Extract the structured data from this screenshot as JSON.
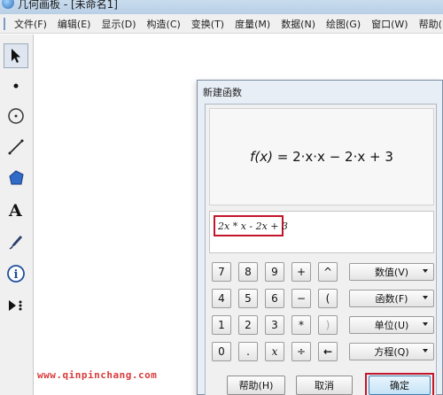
{
  "window": {
    "title": "几何画板 - [未命名1]"
  },
  "menu": [
    "文件(F)",
    "编辑(E)",
    "显示(D)",
    "构造(C)",
    "变换(T)",
    "度量(M)",
    "数据(N)",
    "绘图(G)",
    "窗口(W)",
    "帮助(H)"
  ],
  "toolbox": [
    "arrow-tool-icon",
    "point-tool-icon",
    "compass-tool-icon",
    "line-tool-icon",
    "polygon-tool-icon",
    "text-tool-icon",
    "marker-tool-icon",
    "info-tool-icon",
    "custom-tool-icon"
  ],
  "dialog": {
    "title": "新建函数",
    "formula": {
      "fx": "f(x)",
      "rhs": " = 2·x·x − 2·x + 3"
    },
    "entry_text": "2x * x - 2x + 3",
    "keys": [
      [
        "7",
        "8",
        "9",
        "+",
        "^"
      ],
      [
        "4",
        "5",
        "6",
        "−",
        "("
      ],
      [
        "1",
        "2",
        "3",
        "*",
        ")"
      ],
      [
        "0",
        ".",
        "x",
        "÷",
        "←"
      ]
    ],
    "dropdowns": [
      "数值(V)",
      "函数(F)",
      "单位(U)",
      "方程(Q)"
    ],
    "buttons": {
      "help": "帮助(H)",
      "cancel": "取消",
      "ok": "确定"
    }
  },
  "watermark": "www.qinpinchang.com",
  "colors": {
    "highlight": "#c4162a",
    "watermark": "#d93b3b"
  }
}
